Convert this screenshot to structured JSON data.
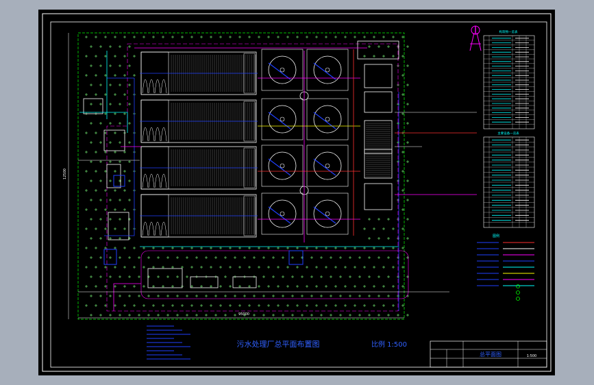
{
  "drawing": {
    "title": "污水处理厂总平面布置图",
    "scale_text": "比例  1:500",
    "title_block_name": "总平面图",
    "title_block_scale": "1:500",
    "dimension_total_width": "95000",
    "dimension_total_height": "12500"
  },
  "colors": {
    "background": "#000000",
    "viewport": "#a7afbb",
    "frame": "#ffffff",
    "green_area": "#00ff00",
    "tree_marks": "#7cff7c",
    "structures": "#ffffff",
    "pipe_blue": "#2040ff",
    "pipe_cyan": "#00ffff",
    "pipe_magenta": "#ff00ff",
    "pipe_red": "#ff3030",
    "pipe_yellow": "#ffff00",
    "text_blue": "#3060ff"
  },
  "tables": {
    "table1_title": "构筑物一览表",
    "table2_title": "主要设备一览表"
  },
  "legend": {
    "title": "图例"
  }
}
